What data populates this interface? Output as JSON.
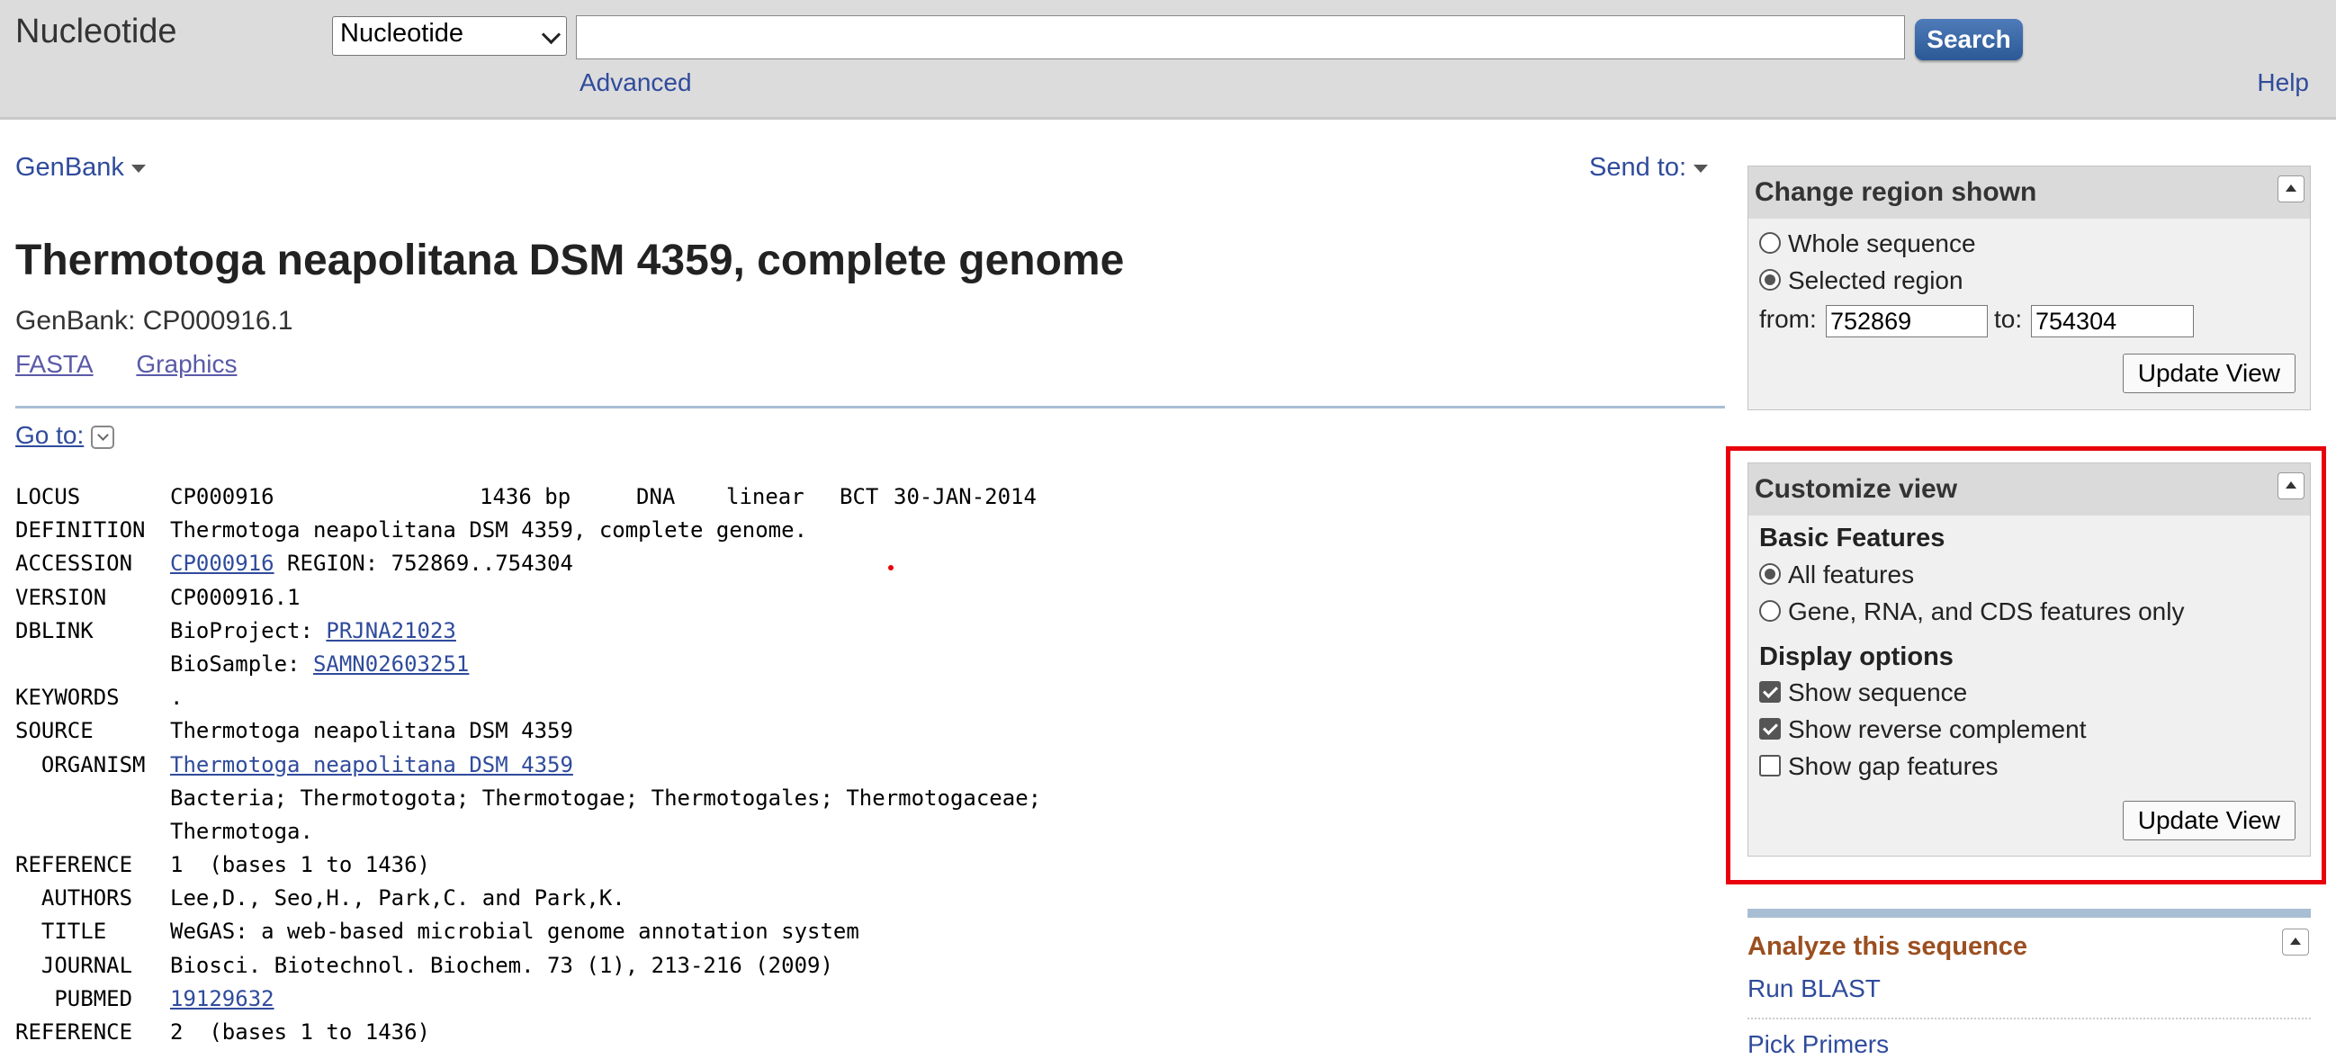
{
  "header": {
    "app_title": "Nucleotide",
    "db_select_value": "Nucleotide",
    "search_value": "",
    "search_button": "Search",
    "advanced_link": "Advanced",
    "help_link": "Help"
  },
  "record": {
    "format_menu": "GenBank",
    "send_to": "Send to:",
    "title": "Thermotoga neapolitana DSM 4359, complete genome",
    "accession_line": "GenBank: CP000916.1",
    "links": [
      "FASTA",
      "Graphics"
    ],
    "goto": "Go to:"
  },
  "flatfile": {
    "locus": {
      "key": "LOCUS",
      "name": "CP000916",
      "length": "1436 bp",
      "type": "DNA",
      "topology": "linear",
      "division": "BCT",
      "date": "30-JAN-2014"
    },
    "definition": {
      "key": "DEFINITION",
      "value": "Thermotoga neapolitana DSM 4359, complete genome."
    },
    "accession": {
      "key": "ACCESSION",
      "link": "CP000916",
      "rest": " REGION: 752869..754304"
    },
    "version": {
      "key": "VERSION",
      "value": "CP000916.1"
    },
    "dblink": {
      "key": "DBLINK",
      "bioproject_label": "BioProject: ",
      "bioproject": "PRJNA21023",
      "biosample_label": "BioSample: ",
      "biosample": "SAMN02603251"
    },
    "keywords": {
      "key": "KEYWORDS",
      "value": "."
    },
    "source": {
      "key": "SOURCE",
      "value": "Thermotoga neapolitana DSM 4359"
    },
    "organism": {
      "key": "  ORGANISM",
      "link": "Thermotoga neapolitana DSM 4359",
      "lineage1": "Bacteria; Thermotogota; Thermotogae; Thermotogales; Thermotogaceae;",
      "lineage2": "Thermotoga."
    },
    "reference1": {
      "key": "REFERENCE",
      "value": "1  (bases 1 to 1436)"
    },
    "authors": {
      "key": "  AUTHORS",
      "value": "Lee,D., Seo,H., Park,C. and Park,K."
    },
    "title": {
      "key": "  TITLE",
      "value": "WeGAS: a web-based microbial genome annotation system"
    },
    "journal": {
      "key": "  JOURNAL",
      "value": "Biosci. Biotechnol. Biochem. 73 (1), 213-216 (2009)"
    },
    "pubmed": {
      "key": "   PUBMED",
      "link": "19129632"
    },
    "reference2": {
      "key": "REFERENCE",
      "value": "2  (bases 1 to 1436)"
    }
  },
  "change_region": {
    "title": "Change region shown",
    "whole": "Whole sequence",
    "selected": "Selected region",
    "from_label": "from:",
    "from_value": "752869",
    "to_label": "to:",
    "to_value": "754304",
    "update": "Update View"
  },
  "customize": {
    "title": "Customize view",
    "basic_features": "Basic Features",
    "all_features": "All features",
    "gene_rna_cds": "Gene, RNA, and CDS features only",
    "display_options": "Display options",
    "show_sequence": "Show sequence",
    "show_reverse": "Show reverse complement",
    "show_gap": "Show gap features",
    "update": "Update View"
  },
  "analyze": {
    "title": "Analyze this sequence",
    "tools": [
      "Run BLAST",
      "Pick Primers"
    ]
  },
  "colors": {
    "header_bg": "#dcdcdc",
    "link": "#2f4b9c",
    "highlight": "#e8000b",
    "analyze_title": "#9b4f20"
  }
}
